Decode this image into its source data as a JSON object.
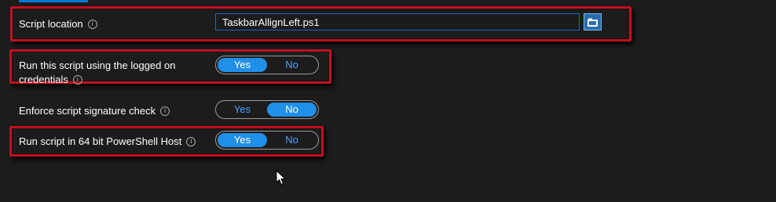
{
  "script_location": {
    "label": "Script location",
    "value": "TaskbarAllignLeft.ps1"
  },
  "settings": [
    {
      "label_line1": "Run this script using the logged on",
      "label_line2": "credentials",
      "options": [
        "Yes",
        "No"
      ],
      "selected": "Yes"
    },
    {
      "label": "Enforce script signature check",
      "options": [
        "Yes",
        "No"
      ],
      "selected": "No"
    },
    {
      "label": "Run script in 64 bit PowerShell Host",
      "options": [
        "Yes",
        "No"
      ],
      "selected": "Yes"
    }
  ],
  "icons": {
    "info": "i",
    "browse": "folder-icon",
    "cursor": "mouse-pointer-icon"
  },
  "colors": {
    "background": "#1c1c1c",
    "accent": "#1f8fe8",
    "highlight": "#c50f1f"
  }
}
